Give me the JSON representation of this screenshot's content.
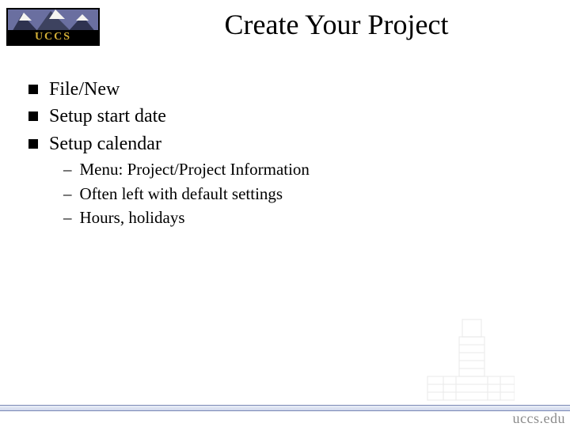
{
  "logo": {
    "text": "UCCS"
  },
  "title": "Create Your Project",
  "bullets": [
    {
      "text": "File/New"
    },
    {
      "text": "Setup start date"
    },
    {
      "text": "Setup calendar",
      "sub": [
        "Menu: Project/Project Information",
        "Often left with default settings",
        "Hours, holidays"
      ]
    }
  ],
  "footer": {
    "url": "uccs.edu"
  }
}
